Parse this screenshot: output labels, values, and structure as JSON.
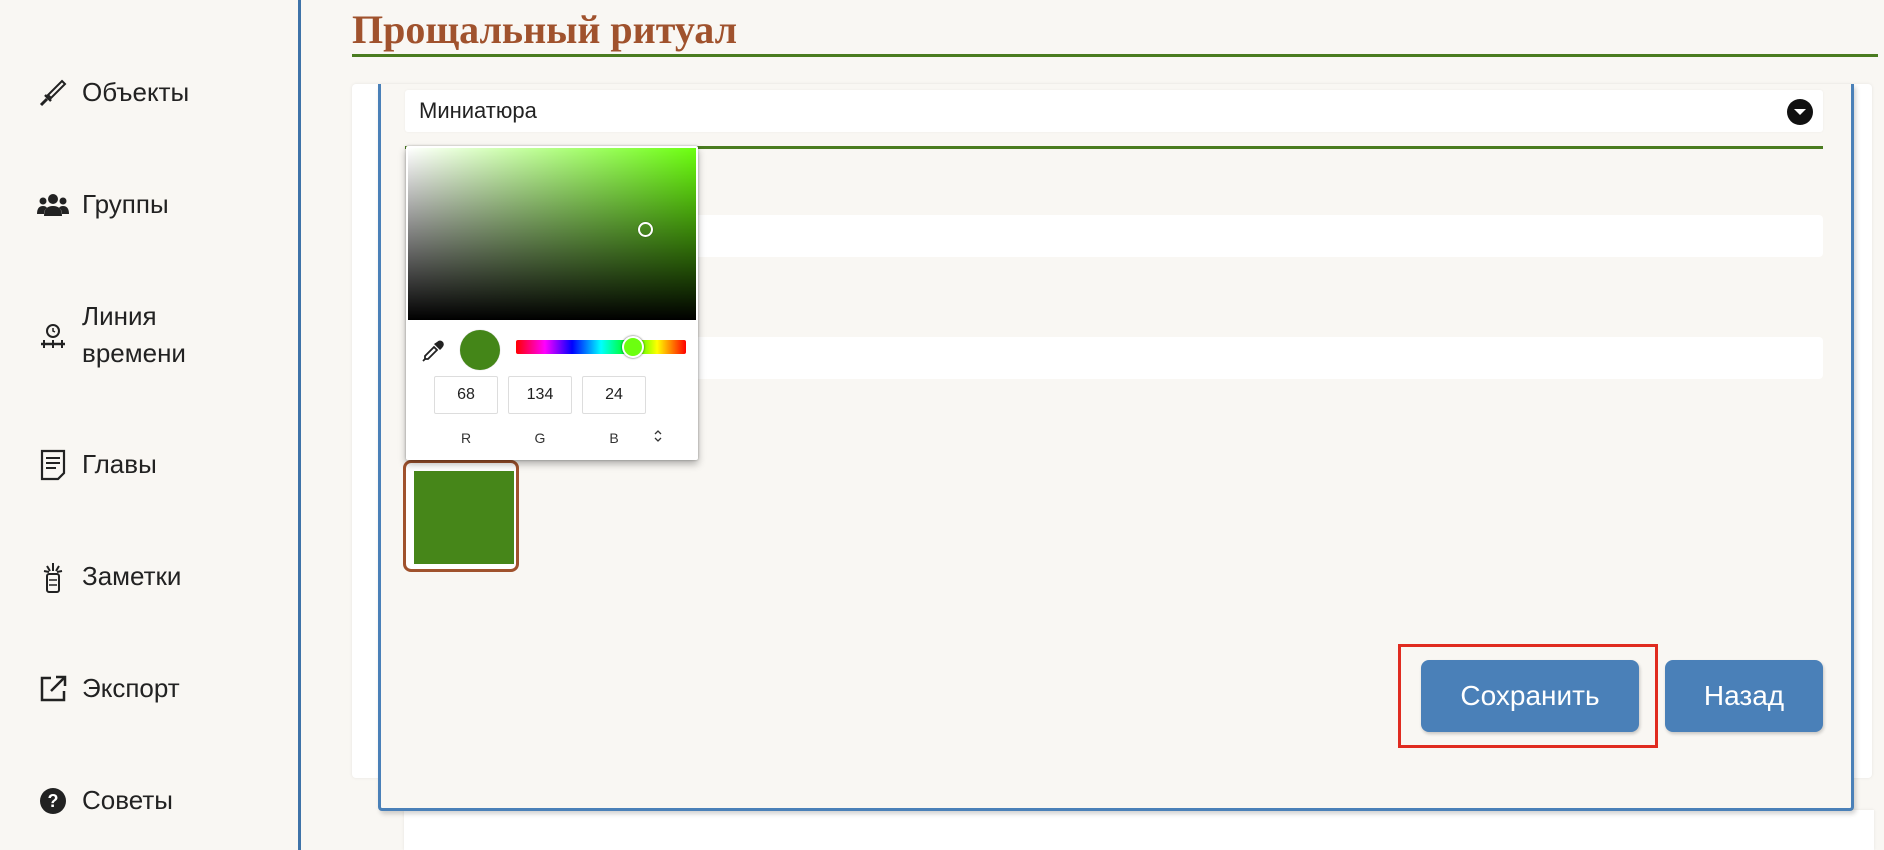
{
  "sidebar": {
    "items": [
      {
        "label": "Объекты",
        "icon": "sword-icon"
      },
      {
        "label": "Группы",
        "icon": "users-icon"
      },
      {
        "label": "Линия времени",
        "icon": "timeline-icon"
      },
      {
        "label": "Главы",
        "icon": "document-icon"
      },
      {
        "label": "Заметки",
        "icon": "notes-icon"
      },
      {
        "label": "Экспорт",
        "icon": "external-link-icon"
      },
      {
        "label": "Советы",
        "icon": "question-circle-icon"
      }
    ]
  },
  "header": {
    "title": "Прощальный ритуал"
  },
  "form": {
    "select_value": "Миниатюра",
    "swatch_color": "#468619"
  },
  "color_picker": {
    "hue_color": "#6cff0f",
    "current_color": "#448618",
    "r": "68",
    "g": "134",
    "b": "24",
    "label_r": "R",
    "label_g": "G",
    "label_b": "B"
  },
  "buttons": {
    "save": "Сохранить",
    "back": "Назад"
  },
  "colors": {
    "accent_blue": "#4a80b8",
    "title_brown": "#a0522d",
    "rule_green": "#4a7c20",
    "highlight_red": "#e02b20"
  }
}
